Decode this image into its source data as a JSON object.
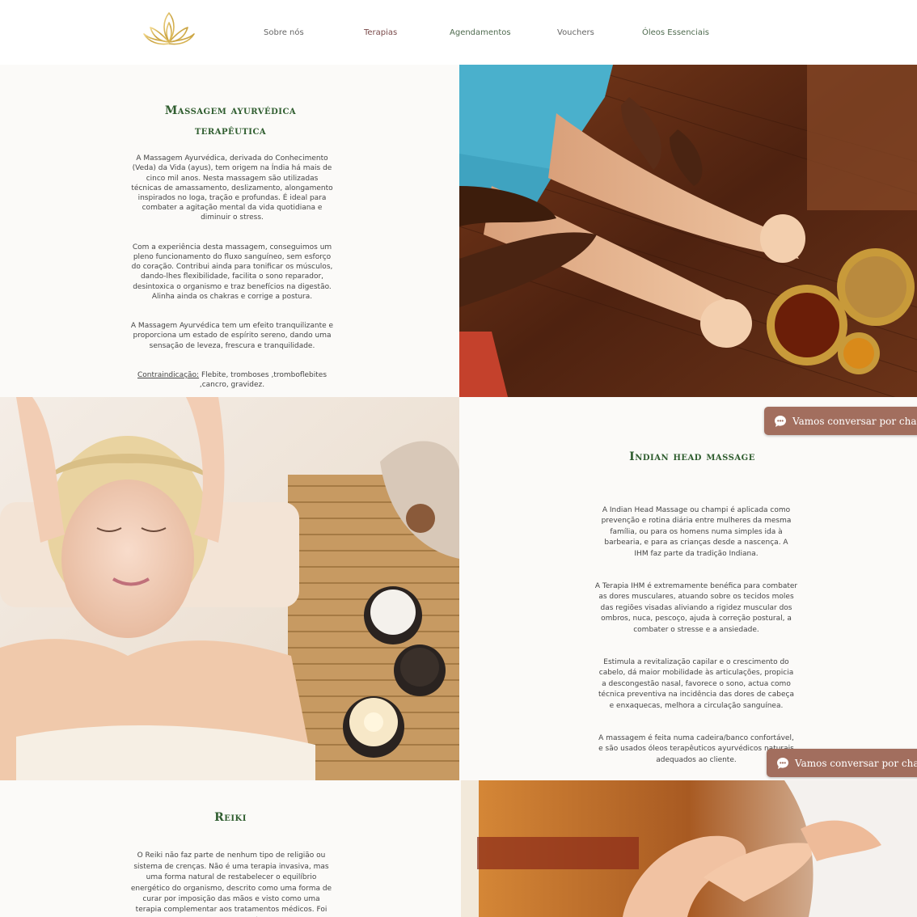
{
  "header": {
    "logo_icon": "lotus-icon",
    "nav": [
      {
        "label": "Sobre nós",
        "color": "#666666"
      },
      {
        "label": "Terapias",
        "color": "#7a4a4a"
      },
      {
        "label": "Agendamentos",
        "color": "#4f6b4f"
      },
      {
        "label": "Vouchers",
        "color": "#666666"
      },
      {
        "label": "Óleos Essenciais",
        "color": "#4f6b4f"
      }
    ]
  },
  "ayurvedic": {
    "title_line1": "Massagem ayurvédica",
    "title_line2": "terapêutica",
    "p1": "A Massagem Ayurvédica, derivada do Conhecimento\n(Veda) da Vida (ayus), tem origem na Índia há mais de\ncinco mil anos. Nesta massagem são utilizadas\ntécnicas de amassamento, deslizamento, alongamento\ninspirados no Ioga, tração e profundas. É ideal para\ncombater a agitação mental da vida quotidiana e\ndiminuir o stress.",
    "p2": "Com a experiência desta massagem, conseguimos um\npleno funcionamento do fluxo sanguíneo, sem esforço\ndo coração. Contribui ainda para tonificar os músculos,\ndando-lhes flexibilidade, facilita o sono reparador,\ndesintoxica o organismo e traz benefícios na digestão.\nAlinha ainda os chakras e corrige a postura.",
    "p3": "A Massagem Ayurvédica tem um efeito tranquilizante e\nproporciona um estado de espírito sereno, dando uma\nsensação de leveza, frescura e tranquilidade.",
    "contra_label": "Contraindicação:",
    "contra_text": " Flebite, tromboses ,tromboflebites\n,cancro, gravidez."
  },
  "indian": {
    "title": "Indian head massage",
    "p1": "A Indian Head Massage ou champi é aplicada como\nprevenção e rotina diária entre mulheres da mesma\nfamília, ou para os homens numa simples ida à\nbarbearia, e para as crianças desde a nascença. A\nIHM faz parte da tradição Indiana.",
    "p2": "A Terapia IHM é extremamente benéfica para combater\nas dores musculares, atuando sobre os tecidos moles\ndas regiões visadas aliviando a rigidez muscular dos\nombros, nuca, pescoço, ajuda à correção postural, a\ncombater o stresse e a ansiedade.",
    "p3": "Estimula a revitalização capilar e o crescimento do\ncabelo, dá maior mobilidade às articulações, propicia\na descongestão nasal, favorece o sono, actua como\ntécnica preventiva na incidência das dores de cabeça\ne enxaquecas, melhora a circulação sanguínea.",
    "p4": "A massagem é feita numa cadeira/banco confortável,\ne são usados óleos terapêuticos ayurvédicos naturais\nadequados ao cliente."
  },
  "reiki": {
    "title": "Reiki",
    "p1": "O Reiki não faz parte de nenhum tipo de religião ou\nsistema de crenças. Não é uma terapia invasiva, mas\numa forma natural de restabelecer o equilíbrio\nenergético do organismo, descrito como uma forma de\ncurar por imposição das mãos e visto como uma\nterapia complementar aos tratamentos médicos. Foi\nvalidada cientificamente através de estudos que"
  },
  "chat": {
    "label": "Vamos conversar por chat",
    "icon": "chat-bubble-icon"
  },
  "colors": {
    "title_green": "#2f5d2f",
    "chat_bg": "#a26e5e"
  }
}
